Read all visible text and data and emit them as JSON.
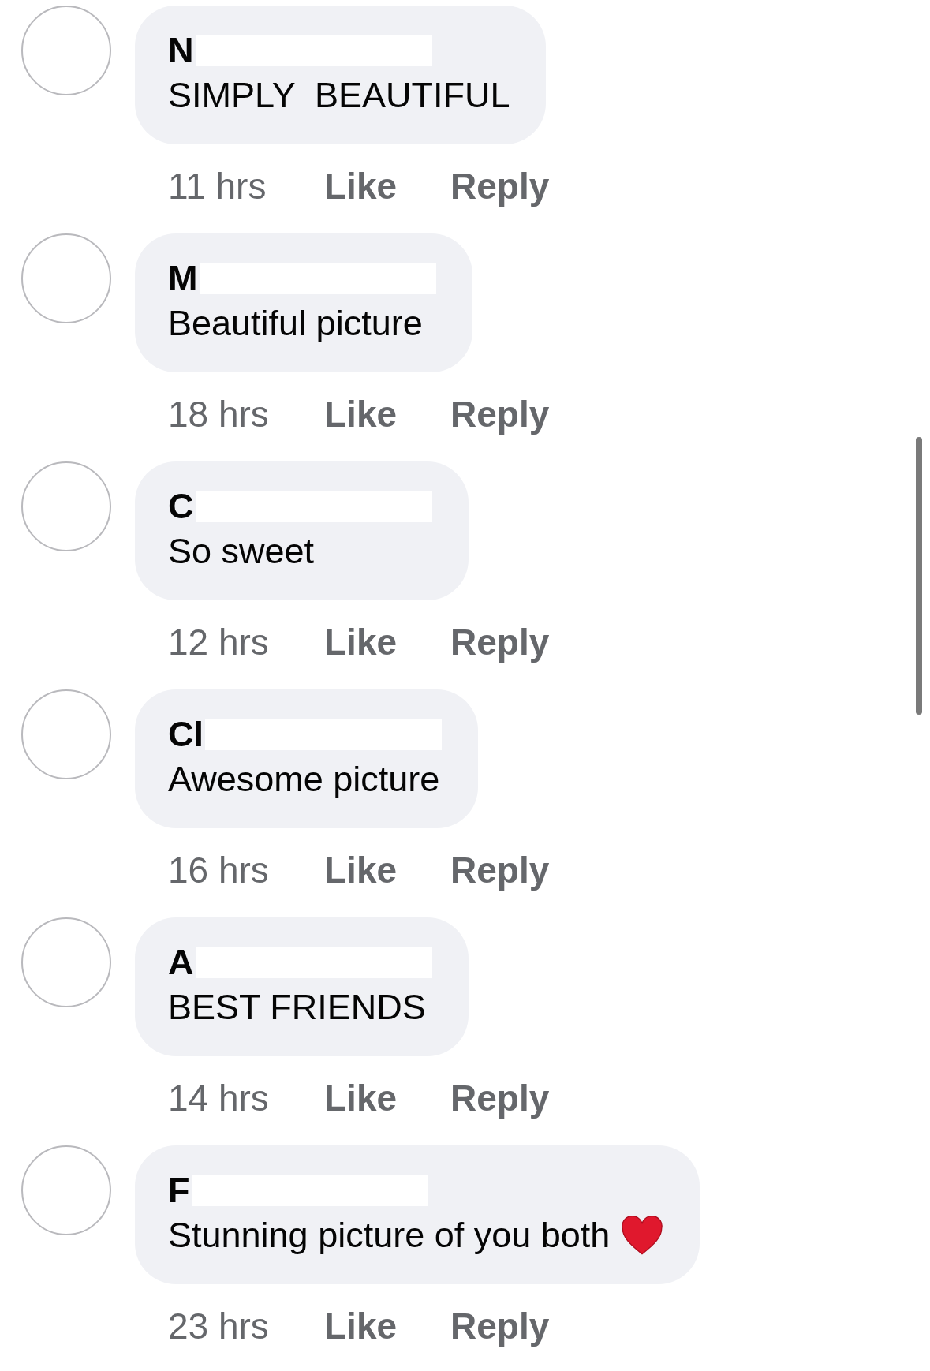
{
  "comments": [
    {
      "name": "N",
      "text": "SIMPLY  BEAUTIFUL",
      "time": "11 hrs",
      "like": "Like",
      "reply": "Reply"
    },
    {
      "name": "M",
      "text": "Beautiful picture",
      "time": "18 hrs",
      "like": "Like",
      "reply": "Reply"
    },
    {
      "name": "C",
      "text": "So sweet",
      "time": "12 hrs",
      "like": "Like",
      "reply": "Reply"
    },
    {
      "name": "Cl",
      "text": "Awesome picture",
      "time": "16 hrs",
      "like": "Like",
      "reply": "Reply"
    },
    {
      "name": "A",
      "text": "BEST FRIENDS",
      "time": "14 hrs",
      "like": "Like",
      "reply": "Reply"
    },
    {
      "name": "F",
      "text": "Stunning picture of you both",
      "heart": true,
      "time": "23 hrs",
      "like": "Like",
      "reply": "Reply"
    }
  ]
}
